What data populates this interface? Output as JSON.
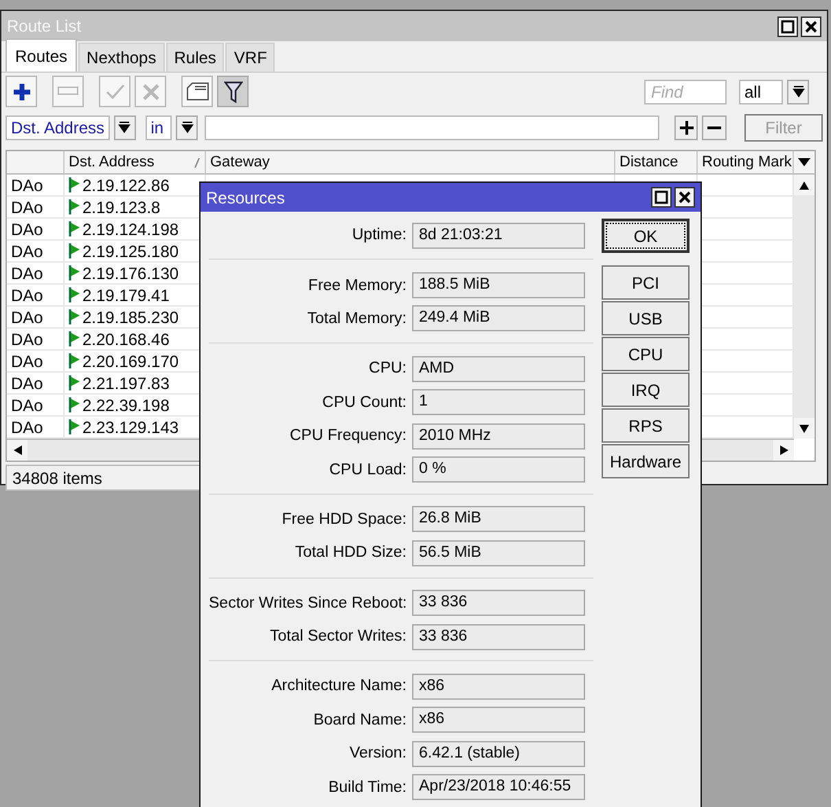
{
  "route_list": {
    "title": "Route List",
    "tabs": [
      {
        "label": "Routes",
        "selected": true
      },
      {
        "label": "Nexthops",
        "selected": false
      },
      {
        "label": "Rules",
        "selected": false
      },
      {
        "label": "VRF",
        "selected": false
      }
    ],
    "toolbar": [
      {
        "kind": "add",
        "disabled": false
      },
      {
        "kind": "remove",
        "disabled": true
      },
      {
        "kind": "enable",
        "disabled": true
      },
      {
        "kind": "disable",
        "disabled": true
      },
      {
        "kind": "comment",
        "disabled": false
      },
      {
        "kind": "filter",
        "on": true
      }
    ],
    "find": {
      "placeholder": "Find",
      "scope": "all"
    },
    "filter": {
      "field": "Dst. Address",
      "operator": "in",
      "button": "Filter"
    },
    "columns": [
      "Dst. Address",
      "Gateway",
      "Distance",
      "Routing Mark"
    ],
    "rows": [
      {
        "flags": "DAo",
        "dst": "2.19.122.86"
      },
      {
        "flags": "DAo",
        "dst": "2.19.123.8"
      },
      {
        "flags": "DAo",
        "dst": "2.19.124.198"
      },
      {
        "flags": "DAo",
        "dst": "2.19.125.180"
      },
      {
        "flags": "DAo",
        "dst": "2.19.176.130"
      },
      {
        "flags": "DAo",
        "dst": "2.19.179.41"
      },
      {
        "flags": "DAo",
        "dst": "2.19.185.230"
      },
      {
        "flags": "DAo",
        "dst": "2.20.168.46"
      },
      {
        "flags": "DAo",
        "dst": "2.20.169.170"
      },
      {
        "flags": "DAo",
        "dst": "2.21.197.83"
      },
      {
        "flags": "DAo",
        "dst": "2.22.39.198"
      },
      {
        "flags": "DAo",
        "dst": "2.23.129.143"
      }
    ],
    "status": "34808 items"
  },
  "resources": {
    "title": "Resources",
    "sections": [
      [
        {
          "label": "Uptime:",
          "value": "8d 21:03:21"
        }
      ],
      [
        {
          "label": "Free Memory:",
          "value": "188.5 MiB"
        },
        {
          "label": "Total Memory:",
          "value": "249.4 MiB"
        }
      ],
      [
        {
          "label": "CPU:",
          "value": "AMD"
        },
        {
          "label": "CPU Count:",
          "value": "1"
        },
        {
          "label": "CPU Frequency:",
          "value": "2010 MHz"
        },
        {
          "label": "CPU Load:",
          "value": "0 %"
        }
      ],
      [
        {
          "label": "Free HDD Space:",
          "value": "26.8 MiB"
        },
        {
          "label": "Total HDD Size:",
          "value": "56.5 MiB"
        }
      ],
      [
        {
          "label": "Sector Writes Since Reboot:",
          "value": "33 836"
        },
        {
          "label": "Total Sector Writes:",
          "value": "33 836"
        }
      ],
      [
        {
          "label": "Architecture Name:",
          "value": "x86"
        },
        {
          "label": "Board Name:",
          "value": "x86"
        },
        {
          "label": "Version:",
          "value": "6.42.1 (stable)"
        },
        {
          "label": "Build Time:",
          "value": "Apr/23/2018 10:46:55"
        }
      ]
    ],
    "buttons": [
      {
        "label": "OK",
        "focused": true
      },
      {
        "label": "PCI",
        "focused": false
      },
      {
        "label": "USB",
        "focused": false
      },
      {
        "label": "CPU",
        "focused": false
      },
      {
        "label": "IRQ",
        "focused": false
      },
      {
        "label": "RPS",
        "focused": false
      },
      {
        "label": "Hardware",
        "focused": false
      }
    ]
  }
}
